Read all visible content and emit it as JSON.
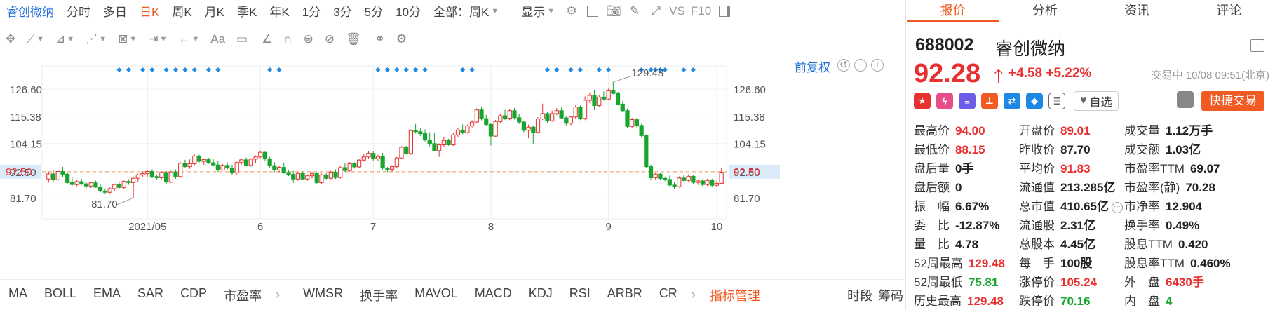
{
  "toolbar": {
    "stock": "睿创微纳",
    "periods": [
      "分时",
      "多日",
      "日K",
      "周K",
      "月K",
      "季K",
      "年K",
      "1分",
      "3分",
      "5分",
      "10分"
    ],
    "active_period": "日K",
    "scope": "全部：周K",
    "display": "显示",
    "vs": "VS",
    "f10": "F10"
  },
  "drawing_tools": [
    "crosshair",
    "line",
    "channel",
    "wave",
    "fib",
    "measure",
    "arrow",
    "text-Aa",
    "comment",
    "angle",
    "arc",
    "cycle",
    "hide",
    "delete",
    "overlap",
    "settings"
  ],
  "chart_controls": {
    "adjust": "前复权"
  },
  "chart_data": {
    "type": "candlestick",
    "y_ticks": [
      "126.60",
      "115.38",
      "104.15",
      "92.50",
      "81.70"
    ],
    "y_tick_values": [
      126.6,
      115.38,
      104.15,
      92.5,
      81.7
    ],
    "x_labels": [
      "2021/05",
      "6",
      "7",
      "8",
      "9",
      "10"
    ],
    "x_label_bar_index": [
      21,
      45,
      69,
      94,
      119,
      142
    ],
    "current_price_line": 92.5,
    "current_price_label": "92.50",
    "high_annotation": "129.48",
    "low_annotation": "81.70",
    "ylim": [
      74.8,
      135
    ],
    "markers_bar_index": [
      15,
      17,
      20,
      22,
      25,
      27,
      29,
      31,
      34,
      36,
      47,
      49,
      70,
      72,
      74,
      76,
      78,
      80,
      88,
      90,
      106,
      108,
      111,
      113,
      117,
      119,
      126,
      128,
      129,
      130,
      131,
      135,
      137
    ],
    "ohlc": [
      [
        89.5,
        92.5,
        88.0,
        91.6
      ],
      [
        91.6,
        93.0,
        88.4,
        89.2
      ],
      [
        89.2,
        93.3,
        88.6,
        92.6
      ],
      [
        92.6,
        94.5,
        90.3,
        91.5
      ],
      [
        91.5,
        92.0,
        87.5,
        88.0
      ],
      [
        88.0,
        90.4,
        86.6,
        87.2
      ],
      [
        87.2,
        89.0,
        86.5,
        88.4
      ],
      [
        88.4,
        89.6,
        87.0,
        87.5
      ],
      [
        87.5,
        88.2,
        85.7,
        86.6
      ],
      [
        86.6,
        88.4,
        85.8,
        87.9
      ],
      [
        87.9,
        88.8,
        85.9,
        86.1
      ],
      [
        86.1,
        87.4,
        84.0,
        84.5
      ],
      [
        84.5,
        85.6,
        83.5,
        84.0
      ],
      [
        84.0,
        86.0,
        83.6,
        85.5
      ],
      [
        85.5,
        87.6,
        84.5,
        87.2
      ],
      [
        87.2,
        88.1,
        85.4,
        86.0
      ],
      [
        86.0,
        88.9,
        85.3,
        88.5
      ],
      [
        88.5,
        89.4,
        87.1,
        88.0
      ],
      [
        88.0,
        90.2,
        81.7,
        89.8
      ],
      [
        89.8,
        91.6,
        88.2,
        91.2
      ],
      [
        91.2,
        92.6,
        90.4,
        91.7
      ],
      [
        91.7,
        93.0,
        90.2,
        92.6
      ],
      [
        92.6,
        93.5,
        89.8,
        90.5
      ],
      [
        90.5,
        91.4,
        89.1,
        90.0
      ],
      [
        90.0,
        92.6,
        89.4,
        92.2
      ],
      [
        92.2,
        92.9,
        87.5,
        88.2
      ],
      [
        88.2,
        92.8,
        87.8,
        92.4
      ],
      [
        92.4,
        93.4,
        89.6,
        90.5
      ],
      [
        90.5,
        96.5,
        90.0,
        96.0
      ],
      [
        96.0,
        97.4,
        94.2,
        94.6
      ],
      [
        94.6,
        97.6,
        93.7,
        95.8
      ],
      [
        95.8,
        99.6,
        95.2,
        99.0
      ],
      [
        99.0,
        99.5,
        96.3,
        96.8
      ],
      [
        96.8,
        97.9,
        95.4,
        97.5
      ],
      [
        97.5,
        98.2,
        95.7,
        96.2
      ],
      [
        96.2,
        97.9,
        94.7,
        95.3
      ],
      [
        95.3,
        96.8,
        92.4,
        93.2
      ],
      [
        93.2,
        95.6,
        92.9,
        95.1
      ],
      [
        95.1,
        96.3,
        93.5,
        94.0
      ],
      [
        94.0,
        95.4,
        91.2,
        92.0
      ],
      [
        92.0,
        96.6,
        91.4,
        96.3
      ],
      [
        96.3,
        98.0,
        95.5,
        97.4
      ],
      [
        97.4,
        98.4,
        94.7,
        95.1
      ],
      [
        95.1,
        98.1,
        94.6,
        97.7
      ],
      [
        97.7,
        99.2,
        96.2,
        98.6
      ],
      [
        98.6,
        101.2,
        98.1,
        100.5
      ],
      [
        100.5,
        100.8,
        97.1,
        97.8
      ],
      [
        97.8,
        98.7,
        94.2,
        95.0
      ],
      [
        95.0,
        96.5,
        92.3,
        93.2
      ],
      [
        93.2,
        95.0,
        92.2,
        94.3
      ],
      [
        94.3,
        96.3,
        91.7,
        92.2
      ],
      [
        92.2,
        93.0,
        90.7,
        91.4
      ],
      [
        91.4,
        92.9,
        87.9,
        89.5
      ],
      [
        89.5,
        92.5,
        88.8,
        91.8
      ],
      [
        91.8,
        92.6,
        89.0,
        89.5
      ],
      [
        89.5,
        91.4,
        88.8,
        90.8
      ],
      [
        90.8,
        92.3,
        89.7,
        91.7
      ],
      [
        91.7,
        92.3,
        87.4,
        88.0
      ],
      [
        88.0,
        91.8,
        87.2,
        91.2
      ],
      [
        91.2,
        92.2,
        89.0,
        89.8
      ],
      [
        89.8,
        92.9,
        89.4,
        92.3
      ],
      [
        92.3,
        93.4,
        89.5,
        90.1
      ],
      [
        90.1,
        94.9,
        89.7,
        94.2
      ],
      [
        94.2,
        96.0,
        92.4,
        93.0
      ],
      [
        93.0,
        96.5,
        92.6,
        95.8
      ],
      [
        95.8,
        96.3,
        93.8,
        94.5
      ],
      [
        94.5,
        97.9,
        94.1,
        97.3
      ],
      [
        97.3,
        99.8,
        96.7,
        98.6
      ],
      [
        98.6,
        101.0,
        97.8,
        100.1
      ],
      [
        100.1,
        100.9,
        97.1,
        97.8
      ],
      [
        97.8,
        99.5,
        97.0,
        98.8
      ],
      [
        98.8,
        100.3,
        93.4,
        94.0
      ],
      [
        94.0,
        94.5,
        92.3,
        93.5
      ],
      [
        93.5,
        95.2,
        92.5,
        94.6
      ],
      [
        94.6,
        98.6,
        94.0,
        98.2
      ],
      [
        98.2,
        103.1,
        97.7,
        102.6
      ],
      [
        102.6,
        103.2,
        99.6,
        100.0
      ],
      [
        100.0,
        110.0,
        99.5,
        109.5
      ],
      [
        109.5,
        112.2,
        108.3,
        109.0
      ],
      [
        109.0,
        110.5,
        107.3,
        108.2
      ],
      [
        108.2,
        110.0,
        105.0,
        105.6
      ],
      [
        105.6,
        108.8,
        103.0,
        104.1
      ],
      [
        104.1,
        108.6,
        102.4,
        101.2
      ],
      [
        101.2,
        104.2,
        98.6,
        103.6
      ],
      [
        103.6,
        106.8,
        102.8,
        105.4
      ],
      [
        105.4,
        106.1,
        103.2,
        103.6
      ],
      [
        103.6,
        108.4,
        103.1,
        107.7
      ],
      [
        107.7,
        110.4,
        106.7,
        109.7
      ],
      [
        109.7,
        112.0,
        108.0,
        108.6
      ],
      [
        108.6,
        112.0,
        108.2,
        111.4
      ],
      [
        111.4,
        113.8,
        110.8,
        113.0
      ],
      [
        113.0,
        118.6,
        112.5,
        118.0
      ],
      [
        118.0,
        119.4,
        113.7,
        114.4
      ],
      [
        114.4,
        116.0,
        111.3,
        112.0
      ],
      [
        112.0,
        112.6,
        103.3,
        107.2
      ],
      [
        107.2,
        113.9,
        106.7,
        113.2
      ],
      [
        113.2,
        116.5,
        112.4,
        115.6
      ],
      [
        115.6,
        118.0,
        113.8,
        114.6
      ],
      [
        114.6,
        118.4,
        113.8,
        117.7
      ],
      [
        117.7,
        118.8,
        114.1,
        114.8
      ],
      [
        114.8,
        116.2,
        112.2,
        113.0
      ],
      [
        113.0,
        113.5,
        108.8,
        109.6
      ],
      [
        109.6,
        112.0,
        106.3,
        110.9
      ],
      [
        110.9,
        111.6,
        103.9,
        108.7
      ],
      [
        108.7,
        115.0,
        108.2,
        114.3
      ],
      [
        114.3,
        120.6,
        113.8,
        116.5
      ],
      [
        116.5,
        117.3,
        112.6,
        113.5
      ],
      [
        113.5,
        117.7,
        113.0,
        116.5
      ],
      [
        116.5,
        118.8,
        115.8,
        117.7
      ],
      [
        117.7,
        119.0,
        114.2,
        114.7
      ],
      [
        114.7,
        115.4,
        111.6,
        112.5
      ],
      [
        112.5,
        115.6,
        111.7,
        115.1
      ],
      [
        115.1,
        119.9,
        114.5,
        119.2
      ],
      [
        119.2,
        119.9,
        113.8,
        114.5
      ],
      [
        114.5,
        123.6,
        113.8,
        122.0
      ],
      [
        122.0,
        125.2,
        120.9,
        124.0
      ],
      [
        124.0,
        126.0,
        118.0,
        119.8
      ],
      [
        119.8,
        124.1,
        119.2,
        123.3
      ],
      [
        123.3,
        125.6,
        121.8,
        122.5
      ],
      [
        122.5,
        126.8,
        122.0,
        125.9
      ],
      [
        125.9,
        129.48,
        124.5,
        124.8
      ],
      [
        124.8,
        125.5,
        119.8,
        120.4
      ],
      [
        120.4,
        121.6,
        117.1,
        117.7
      ],
      [
        117.7,
        118.6,
        110.4,
        111.2
      ],
      [
        111.2,
        114.7,
        110.7,
        114.0
      ],
      [
        114.0,
        114.7,
        110.9,
        111.6
      ],
      [
        111.6,
        112.2,
        106.6,
        107.4
      ],
      [
        107.4,
        107.9,
        94.0,
        94.6
      ],
      [
        94.6,
        95.4,
        89.2,
        90.0
      ],
      [
        90.0,
        92.2,
        89.1,
        91.5
      ],
      [
        91.5,
        92.1,
        89.0,
        89.7
      ],
      [
        89.7,
        90.5,
        88.6,
        89.3
      ],
      [
        89.3,
        90.9,
        86.4,
        87.0
      ],
      [
        87.0,
        88.1,
        85.5,
        86.3
      ],
      [
        86.3,
        90.6,
        85.9,
        89.9
      ],
      [
        89.9,
        91.1,
        88.3,
        88.9
      ],
      [
        88.9,
        91.4,
        88.4,
        90.6
      ],
      [
        90.6,
        91.3,
        87.4,
        88.1
      ],
      [
        88.1,
        89.3,
        87.1,
        88.7
      ],
      [
        88.7,
        89.4,
        86.5,
        87.2
      ],
      [
        87.2,
        89.6,
        86.6,
        88.9
      ],
      [
        88.9,
        89.6,
        86.3,
        86.9
      ],
      [
        86.9,
        88.8,
        86.1,
        87.7
      ],
      [
        87.7,
        94.0,
        87.4,
        92.28
      ]
    ]
  },
  "indicators": {
    "main": [
      "MA",
      "BOLL",
      "EMA",
      "SAR",
      "CDP",
      "市盈率"
    ],
    "sub": [
      "WMSR",
      "换手率",
      "MAVOL",
      "MACD",
      "KDJ",
      "RSI",
      "ARBR",
      "CR"
    ],
    "manage": "指标管理",
    "right": [
      "时段",
      "筹码"
    ]
  },
  "right_tabs": [
    "报价",
    "分析",
    "资讯",
    "评论"
  ],
  "active_tab": "报价",
  "quote": {
    "code": "688002",
    "name": "睿创微纳",
    "price": "92.28",
    "change": "+4.58",
    "change_pct": "+5.22%",
    "status": "交易中 10/08 09:51(北京)",
    "watch": "自选",
    "trade": "快捷交易"
  },
  "stats": [
    [
      {
        "label": "最高价",
        "value": "94.00",
        "color": "red"
      },
      {
        "label": "开盘价",
        "value": "89.01",
        "color": "red"
      },
      {
        "label": "成交量",
        "value": "1.12万手",
        "color": "blk"
      }
    ],
    [
      {
        "label": "最低价",
        "value": "88.15",
        "color": "red"
      },
      {
        "label": "昨收价",
        "value": "87.70",
        "color": "blk"
      },
      {
        "label": "成交额",
        "value": "1.03亿",
        "color": "blk"
      }
    ],
    [
      {
        "label": "盘后量",
        "value": "0手",
        "color": "blk"
      },
      {
        "label": "平均价",
        "value": "91.83",
        "color": "red"
      },
      {
        "label": "市盈率TTM",
        "value": "69.07",
        "color": "blk"
      }
    ],
    [
      {
        "label": "盘后额",
        "value": "0",
        "color": "blk"
      },
      {
        "label": "流通值",
        "value": "213.285亿",
        "color": "blk"
      },
      {
        "label": "市盈率(静)",
        "value": "70.28",
        "color": "blk"
      }
    ],
    [
      {
        "label": "振　幅",
        "value": "6.67%",
        "color": "blk"
      },
      {
        "label": "总市值",
        "value": "410.65亿",
        "color": "blk"
      },
      {
        "label": "市净率",
        "value": "12.904",
        "color": "blk"
      }
    ],
    [
      {
        "label": "委　比",
        "value": "-12.87%",
        "color": "blk"
      },
      {
        "label": "流通股",
        "value": "2.31亿",
        "color": "blk"
      },
      {
        "label": "换手率",
        "value": "0.49%",
        "color": "blk"
      }
    ],
    [
      {
        "label": "量　比",
        "value": "4.78",
        "color": "blk"
      },
      {
        "label": "总股本",
        "value": "4.45亿",
        "color": "blk"
      },
      {
        "label": "股息TTM",
        "value": "0.420",
        "color": "blk"
      }
    ],
    [
      {
        "label": "52周最高",
        "value": "129.48",
        "color": "red"
      },
      {
        "label": "每　手",
        "value": "100股",
        "color": "blk"
      },
      {
        "label": "股息率TTM",
        "value": "0.460%",
        "color": "blk"
      }
    ],
    [
      {
        "label": "52周最低",
        "value": "75.81",
        "color": "grn"
      },
      {
        "label": "涨停价",
        "value": "105.24",
        "color": "red"
      },
      {
        "label": "外　盘",
        "value": "6430手",
        "color": "red"
      }
    ],
    [
      {
        "label": "历史最高",
        "value": "129.48",
        "color": "red"
      },
      {
        "label": "跌停价",
        "value": "70.16",
        "color": "grn"
      },
      {
        "label": "内　盘",
        "value": "4",
        "color": "grn"
      }
    ]
  ],
  "colors": {
    "up": "#e93030",
    "down": "#17a52d",
    "accent": "#f15a22",
    "link": "#1e6fd9",
    "marker": "#1e88e5",
    "price_line": "#f39a58"
  }
}
